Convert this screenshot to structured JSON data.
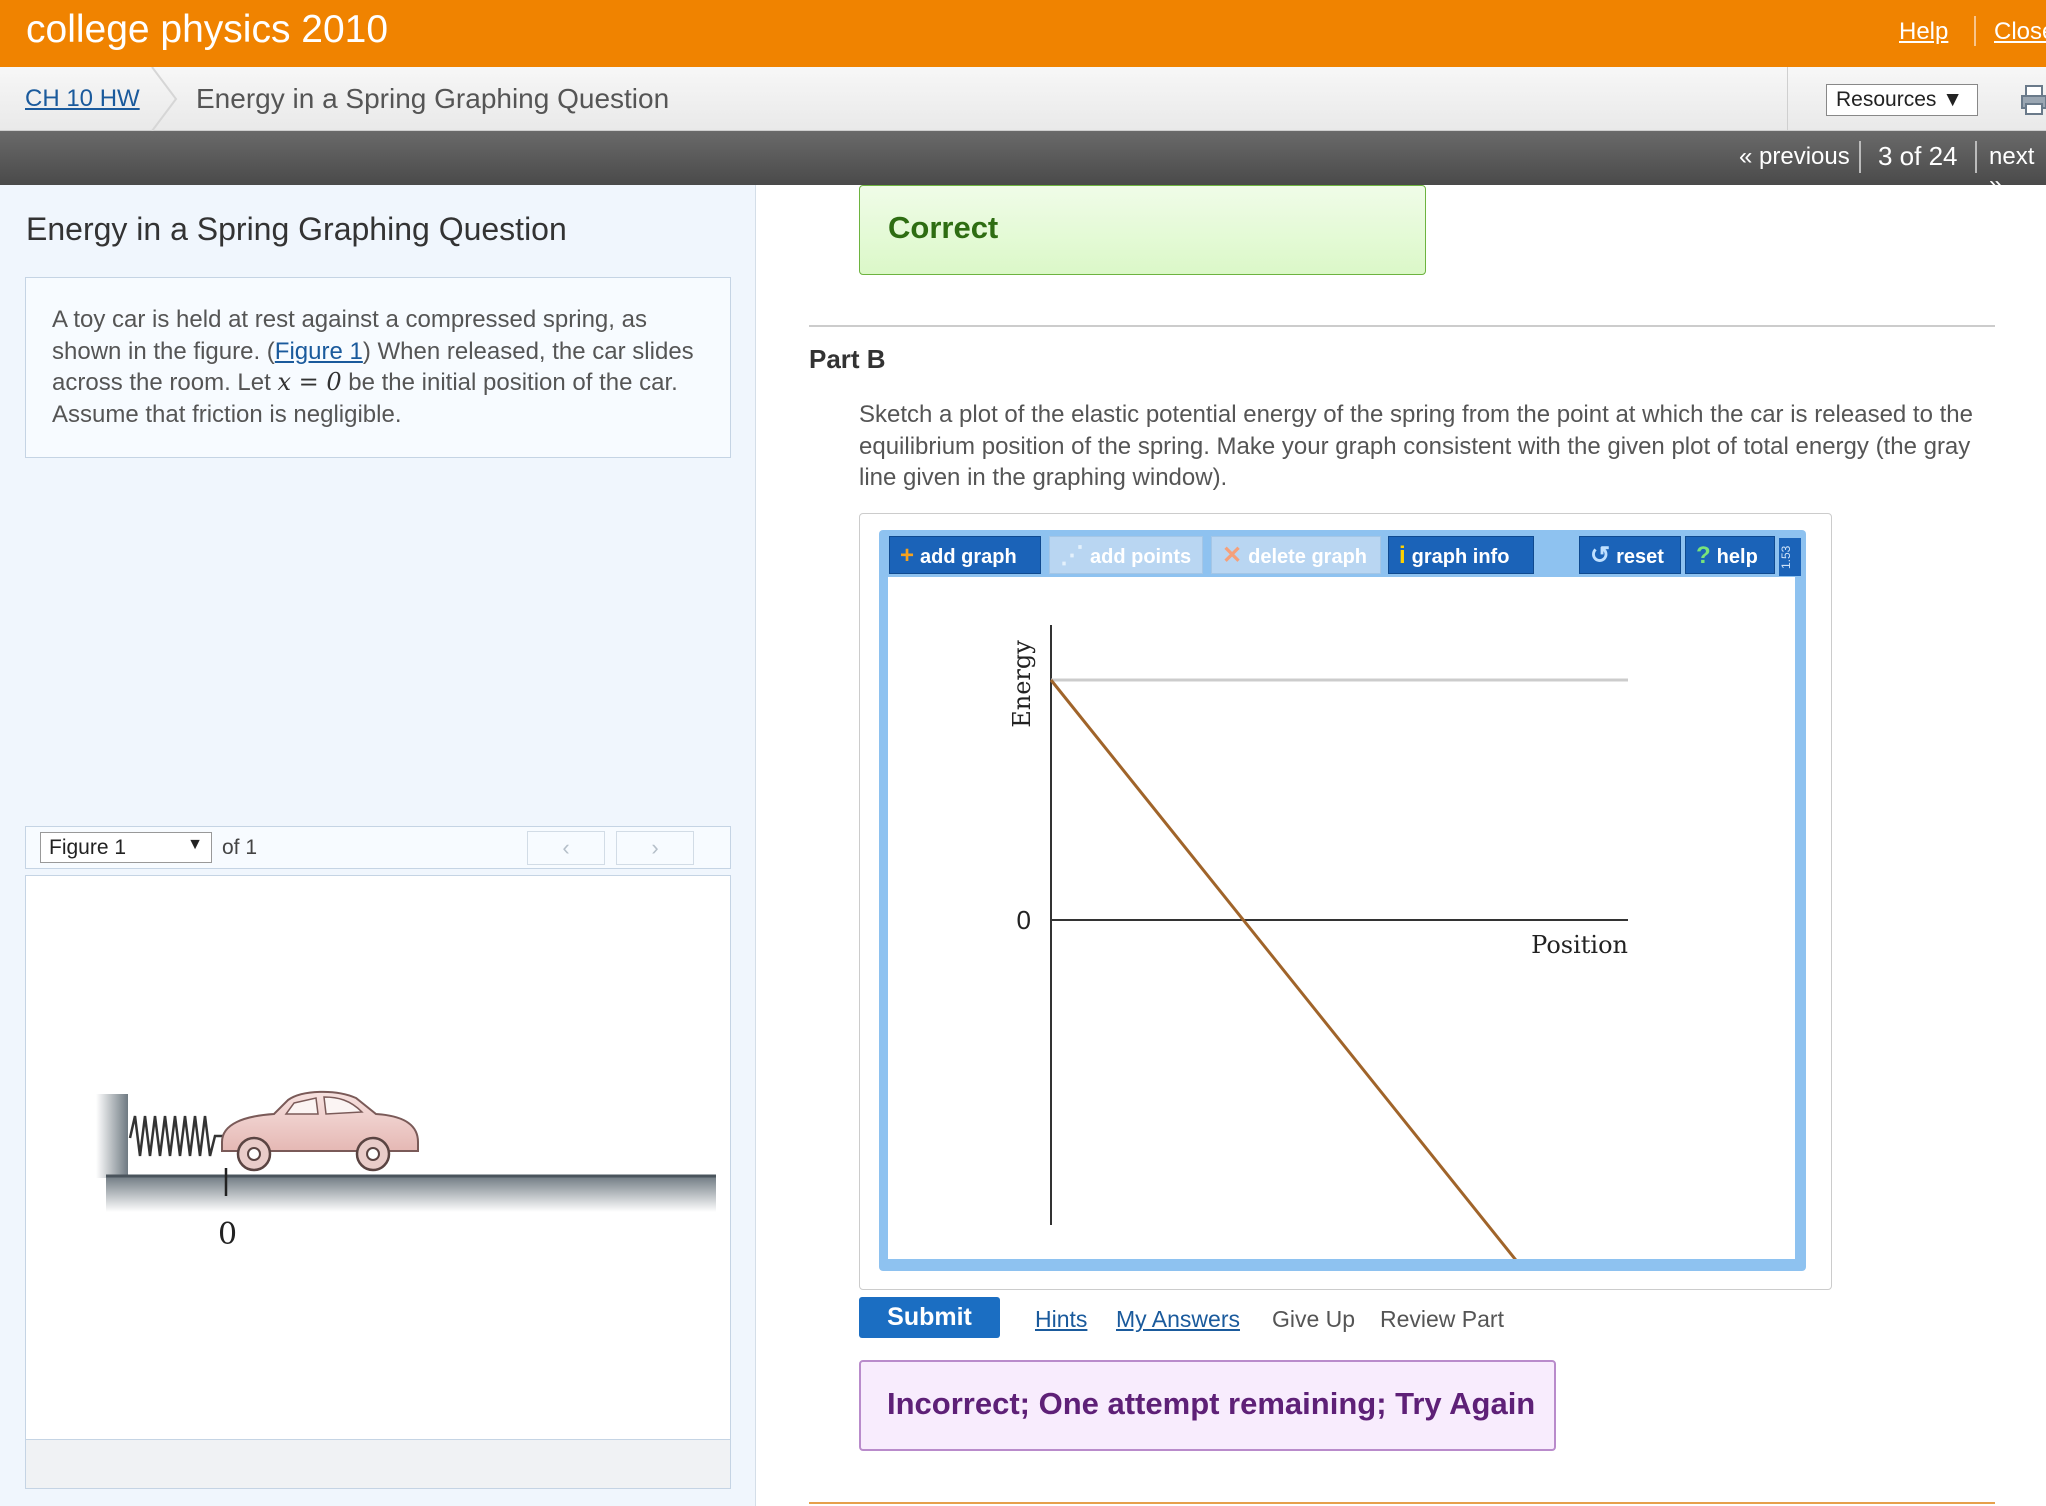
{
  "topbar": {
    "title": "college physics 2010",
    "help": "Help",
    "close": "Close"
  },
  "breadcrumb": {
    "assignment": "CH 10 HW",
    "current": "Energy in a Spring Graphing Question",
    "resources": "Resources ▼"
  },
  "pager": {
    "previous": "« previous",
    "count": "3 of 24",
    "next": "next »"
  },
  "problem": {
    "title": "Energy in a Spring Graphing Question",
    "text_1": "A toy car is held at rest against a compressed spring, as shown in the figure. (",
    "figure_link": "Figure 1",
    "text_2": ") When released, the car slides across the room. Let ",
    "math": "x = 0",
    "text_3": " be the initial position of the car. Assume that friction is negligible."
  },
  "figure": {
    "select": "Figure 1",
    "of": "of 1",
    "prev": "‹",
    "next": "›",
    "axis_zero": "0"
  },
  "status": {
    "correct": "Correct",
    "incorrect": "Incorrect; One attempt remaining; Try Again"
  },
  "part": {
    "label": "Part B",
    "question": "Sketch a plot of the elastic potential energy of the spring from the point at which the car is released to the equilibrium position of the spring. Make your graph consistent with the given plot of total energy (the gray line given in the graphing window)."
  },
  "toolbar": {
    "add_graph": "add graph",
    "add_points": "add points",
    "delete_graph": "delete graph",
    "graph_info": "graph info",
    "reset": "reset",
    "help": "help",
    "version": "1.53"
  },
  "chart_data": {
    "type": "line",
    "xlabel": "Position",
    "ylabel": "Energy",
    "y_tick": "0",
    "series": [
      {
        "values": [
          [
            0,
            1
          ],
          [
            1,
            1
          ]
        ],
        "color": "#cccccc"
      },
      {
        "values": [
          [
            0,
            1
          ],
          [
            1,
            -2
          ]
        ],
        "color": "#a0642a"
      }
    ]
  },
  "actions": {
    "submit": "Submit",
    "hints": "Hints",
    "my_answers": "My Answers",
    "give_up": "Give Up",
    "review_part": "Review Part"
  }
}
